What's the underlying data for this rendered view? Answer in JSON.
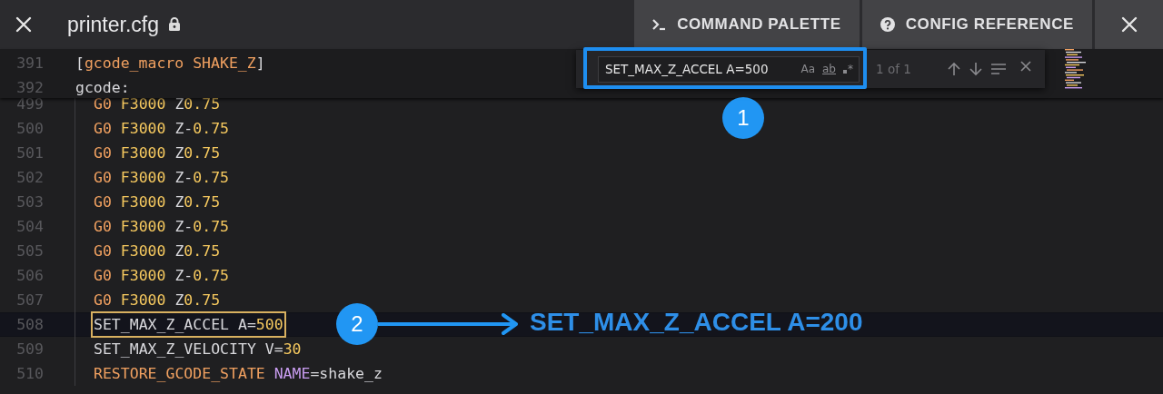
{
  "header": {
    "title": "printer.cfg",
    "locked": true,
    "actions": [
      {
        "kind": "terminal",
        "label": "COMMAND PALETTE"
      },
      {
        "kind": "help",
        "label": "CONFIG REFERENCE"
      }
    ]
  },
  "sticky_lines": [
    {
      "number": "391",
      "tokens": [
        {
          "text": "[",
          "kind": "plain"
        },
        {
          "text": "gcode_macro SHAKE_Z",
          "kind": "keyword"
        },
        {
          "text": "]",
          "kind": "plain"
        }
      ]
    },
    {
      "number": "392",
      "tokens": [
        {
          "text": "gcode:",
          "kind": "plain"
        }
      ]
    }
  ],
  "lines": [
    {
      "number": "499",
      "current": false,
      "match": false,
      "tokens": [
        {
          "text": "G0 ",
          "kind": "keyword"
        },
        {
          "text": "F3000",
          "kind": "number"
        },
        {
          "text": " Z",
          "kind": "plain"
        },
        {
          "text": "0.75",
          "kind": "number"
        }
      ]
    },
    {
      "number": "500",
      "current": false,
      "match": false,
      "tokens": [
        {
          "text": "G0 ",
          "kind": "keyword"
        },
        {
          "text": "F3000",
          "kind": "number"
        },
        {
          "text": " Z-",
          "kind": "plain"
        },
        {
          "text": "0.75",
          "kind": "number"
        }
      ]
    },
    {
      "number": "501",
      "current": false,
      "match": false,
      "tokens": [
        {
          "text": "G0 ",
          "kind": "keyword"
        },
        {
          "text": "F3000",
          "kind": "number"
        },
        {
          "text": " Z",
          "kind": "plain"
        },
        {
          "text": "0.75",
          "kind": "number"
        }
      ]
    },
    {
      "number": "502",
      "current": false,
      "match": false,
      "tokens": [
        {
          "text": "G0 ",
          "kind": "keyword"
        },
        {
          "text": "F3000",
          "kind": "number"
        },
        {
          "text": " Z-",
          "kind": "plain"
        },
        {
          "text": "0.75",
          "kind": "number"
        }
      ]
    },
    {
      "number": "503",
      "current": false,
      "match": false,
      "tokens": [
        {
          "text": "G0 ",
          "kind": "keyword"
        },
        {
          "text": "F3000",
          "kind": "number"
        },
        {
          "text": " Z",
          "kind": "plain"
        },
        {
          "text": "0.75",
          "kind": "number"
        }
      ]
    },
    {
      "number": "504",
      "current": false,
      "match": false,
      "tokens": [
        {
          "text": "G0 ",
          "kind": "keyword"
        },
        {
          "text": "F3000",
          "kind": "number"
        },
        {
          "text": " Z-",
          "kind": "plain"
        },
        {
          "text": "0.75",
          "kind": "number"
        }
      ]
    },
    {
      "number": "505",
      "current": false,
      "match": false,
      "tokens": [
        {
          "text": "G0 ",
          "kind": "keyword"
        },
        {
          "text": "F3000",
          "kind": "number"
        },
        {
          "text": " Z",
          "kind": "plain"
        },
        {
          "text": "0.75",
          "kind": "number"
        }
      ]
    },
    {
      "number": "506",
      "current": false,
      "match": false,
      "tokens": [
        {
          "text": "G0 ",
          "kind": "keyword"
        },
        {
          "text": "F3000",
          "kind": "number"
        },
        {
          "text": " Z-",
          "kind": "plain"
        },
        {
          "text": "0.75",
          "kind": "number"
        }
      ]
    },
    {
      "number": "507",
      "current": false,
      "match": false,
      "tokens": [
        {
          "text": "G0 ",
          "kind": "keyword"
        },
        {
          "text": "F3000",
          "kind": "number"
        },
        {
          "text": " Z",
          "kind": "plain"
        },
        {
          "text": "0.75",
          "kind": "number"
        }
      ]
    },
    {
      "number": "508",
      "current": true,
      "match": true,
      "tokens": [
        {
          "text": "SET_MAX_Z_ACCEL A=",
          "kind": "plain"
        },
        {
          "text": "500",
          "kind": "number"
        }
      ]
    },
    {
      "number": "509",
      "current": false,
      "match": false,
      "tokens": [
        {
          "text": "SET_MAX_Z_VELOCITY V=",
          "kind": "plain"
        },
        {
          "text": "30",
          "kind": "number"
        }
      ]
    },
    {
      "number": "510",
      "current": false,
      "match": false,
      "tokens": [
        {
          "text": "RESTORE_GCODE_STATE ",
          "kind": "keyword"
        },
        {
          "text": "NAME",
          "kind": "param"
        },
        {
          "text": "=shake_z",
          "kind": "plain"
        }
      ]
    }
  ],
  "find_widget": {
    "value": "SET_MAX_Z_ACCEL A=500",
    "options": [
      "Aa",
      "ab",
      "*"
    ],
    "match_count": "1 of 1"
  },
  "annotations": [
    {
      "label": "1"
    },
    {
      "label": "2",
      "note": "SET_MAX_Z_ACCEL A=200"
    }
  ]
}
